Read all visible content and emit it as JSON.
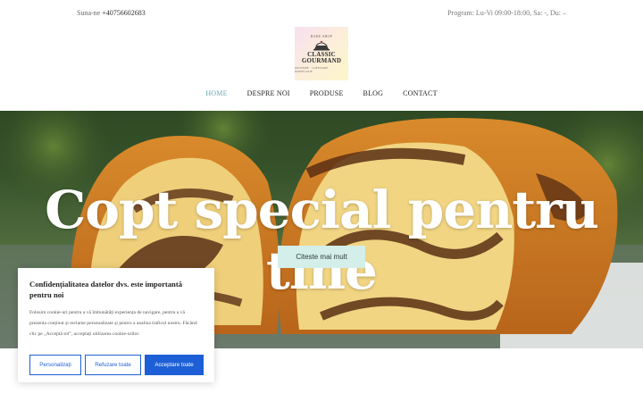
{
  "topbar": {
    "phone_label": "Suna-ne",
    "phone_number": "+40756602683",
    "hours": "Program: Lu-Vi 09:00-18:00, Sa: -, Du: –"
  },
  "logo": {
    "line1": "CLASSIC",
    "line2": "GOURMAND",
    "small_top": "BAKE SHOP",
    "tagline": "PATISERIE · COFETARIE · PANIFICATIE",
    "icon": "cake-icon"
  },
  "nav": {
    "items": [
      {
        "label": "HOME",
        "active": true
      },
      {
        "label": "DESPRE NOI"
      },
      {
        "label": "PRODUSE"
      },
      {
        "label": "BLOG"
      },
      {
        "label": "CONTACT"
      }
    ]
  },
  "hero": {
    "title": "Copt special pentru tine",
    "cta_label": "Citeste mai mult"
  },
  "cookie_banner": {
    "title": "Confidențialitatea datelor dvs. este importantă pentru noi",
    "text": "Folosim cookie-uri pentru a vă îmbunătăți experiența de navigare, pentru a vă prezenta conținut și reclame personalizate și pentru a analiza traficul nostru. Făcând clic pe „Acceptă tot”, acceptați utilizarea cookie-urilor.",
    "buttons": {
      "customize": "Personalizați",
      "reject": "Refuzare toate",
      "accept": "Acceptare toate"
    }
  },
  "colors": {
    "accent_nav": "#6aa8b0",
    "cta_bg": "#d4eeea",
    "cookie_blue": "#1d5fd6"
  }
}
